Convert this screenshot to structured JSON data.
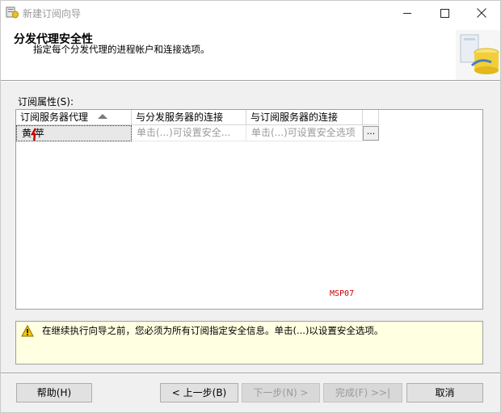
{
  "window": {
    "title": "新建订阅向导",
    "minimize_icon": "minimize-icon",
    "maximize_icon": "maximize-icon",
    "close_icon": "close-icon"
  },
  "header": {
    "title": "分发代理安全性",
    "subtitle": "指定每个分发代理的进程帐户和连接选项。",
    "graphic_icon": "wizard-database-icon"
  },
  "properties": {
    "label": "订阅属性(S):",
    "columns": [
      "订阅服务器代理",
      "与分发服务器的连接",
      "与订阅服务器的连接"
    ],
    "sort_indicator": "sort-ascending-icon",
    "rows": [
      {
        "agent": "黄  苹",
        "distributor_connection": "单击(...)可设置安全...",
        "subscriber_connection": "单击(...)可设置安全选项",
        "button": "..."
      }
    ],
    "watermark": "MSP07"
  },
  "message": {
    "icon": "warning-icon",
    "text": "在继续执行向导之前，您必须为所有订阅指定安全信息。单击(...)以设置安全选项。"
  },
  "buttons": {
    "help": "帮助(H)",
    "back": "< 上一步(B)",
    "next": "下一步(N) >",
    "finish": "完成(F) >>|",
    "cancel": "取消"
  },
  "colors": {
    "message_background": "#ffffe1",
    "watermark": "#cc0000",
    "selected_cell": "#e8e8e8"
  }
}
